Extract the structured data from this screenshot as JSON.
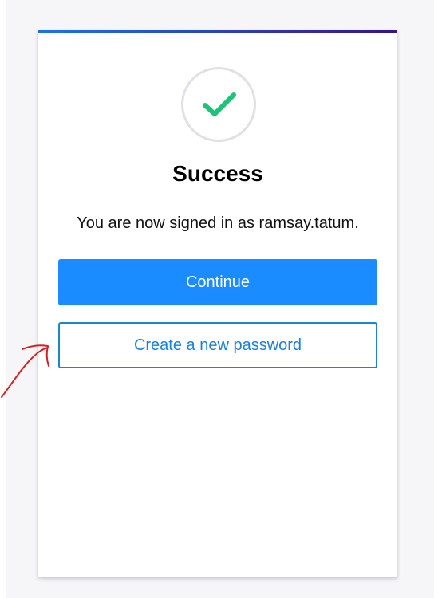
{
  "card": {
    "accent_gradient": [
      "#1a73e8",
      "#3a0f8c"
    ],
    "status_icon": "checkmark-icon",
    "status_icon_color": "#1cc47a",
    "title": "Success",
    "message": "You are now signed in as ramsay.tatum."
  },
  "actions": {
    "continue_label": "Continue",
    "continue_color": "#1a8cff",
    "create_password_label": "Create a new password",
    "create_password_color": "#1f82d2"
  },
  "annotation": {
    "icon": "hand-drawn-arrow-icon",
    "color": "#d42020"
  }
}
